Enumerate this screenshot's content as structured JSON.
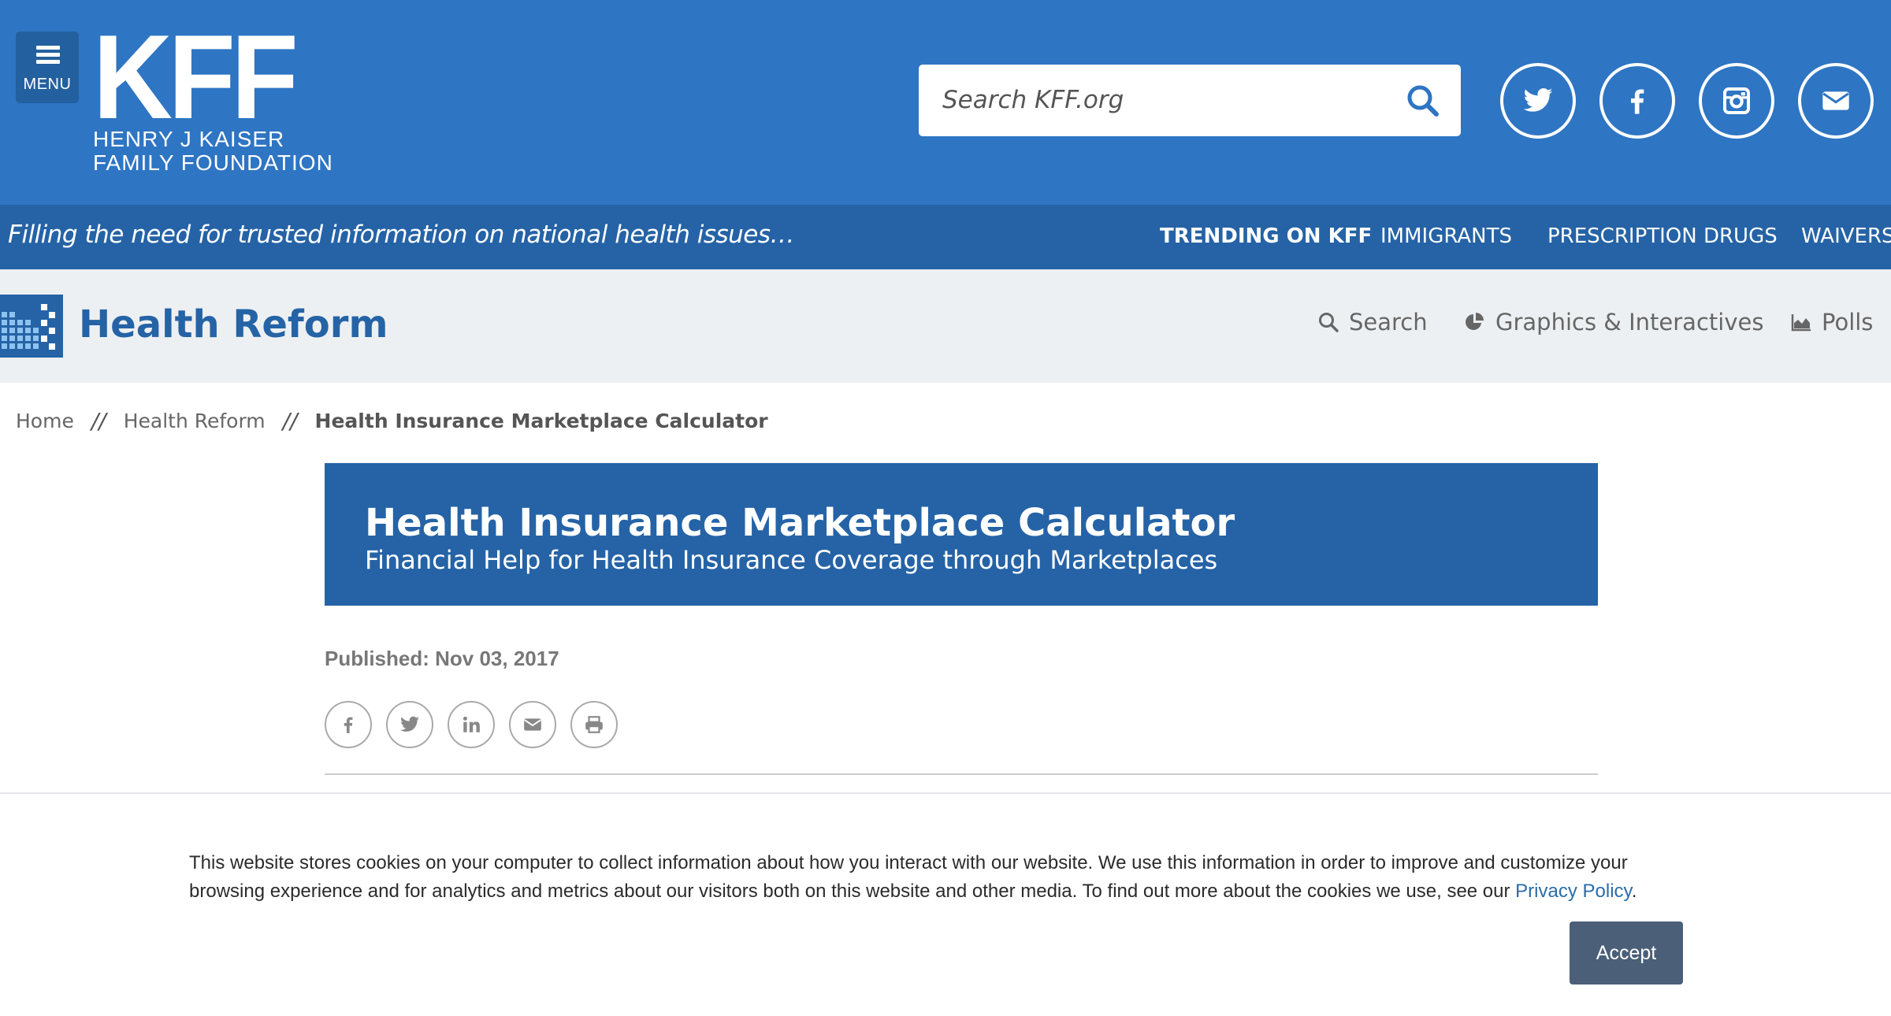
{
  "header": {
    "menu_label": "MENU",
    "logo_mark": "KFF",
    "logo_line1": "HENRY J KAISER",
    "logo_line2": "FAMILY FOUNDATION",
    "search_placeholder": "Search KFF.org",
    "social": [
      "twitter-icon",
      "facebook-icon",
      "instagram-icon",
      "email-icon"
    ],
    "colors": {
      "primary": "#2e75c3",
      "dark": "#2563a6",
      "menu_bg": "#23609f"
    }
  },
  "tagbar": {
    "tagline": "Filling the need for trusted information on national health issues…",
    "trending_label": "TRENDING ON KFF",
    "trending_items": [
      "IMMIGRANTS",
      "PRESCRIPTION DRUGS",
      "WAIVERS"
    ]
  },
  "section": {
    "title": "Health Reform",
    "links": [
      "Search",
      "Graphics & Interactives",
      "Polls"
    ]
  },
  "breadcrumb": {
    "items": [
      "Home",
      "Health Reform"
    ],
    "separator": "//",
    "current": "Health Insurance Marketplace Calculator"
  },
  "article": {
    "title": "Health Insurance Marketplace Calculator",
    "subtitle": "Financial Help for Health Insurance Coverage through Marketplaces",
    "published": "Published: Nov 03, 2017",
    "share_icons": [
      "facebook-icon",
      "twitter-icon",
      "linkedin-icon",
      "email-icon",
      "print-icon"
    ]
  },
  "cookie": {
    "text": "This website stores cookies on your computer to collect information about how you interact with our website. We use this information in order to improve and customize your browsing experience and for analytics and metrics about our visitors both on this website and other media. To find out more about the cookies we use, see our ",
    "link": "Privacy Policy",
    "period": ".",
    "accept_label": "Accept"
  }
}
